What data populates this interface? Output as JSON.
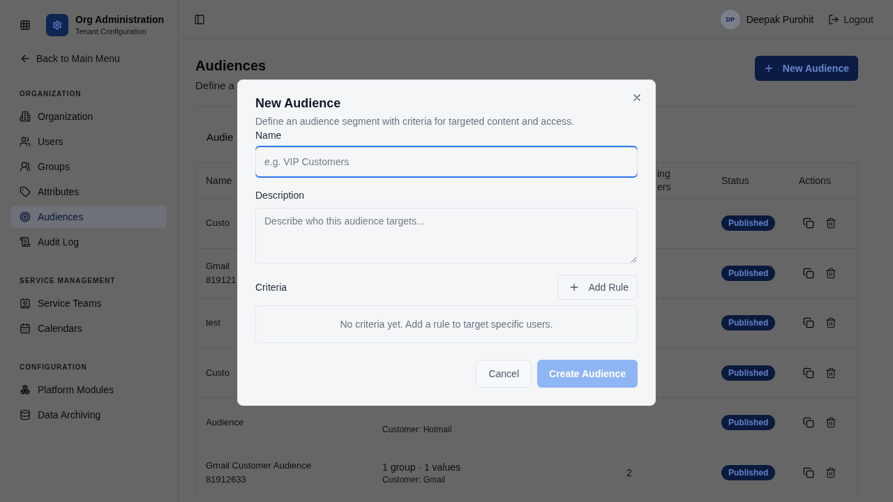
{
  "sidebar": {
    "title": "Org Administration",
    "subtitle": "Tenant Configuration",
    "back_link": "Back to Main Menu",
    "sections": [
      {
        "heading": "ORGANIZATION",
        "items": [
          {
            "label": "Organization",
            "selected": false
          },
          {
            "label": "Users",
            "selected": false
          },
          {
            "label": "Groups",
            "selected": false
          },
          {
            "label": "Attributes",
            "selected": false
          },
          {
            "label": "Audiences",
            "selected": true
          },
          {
            "label": "Audit Log",
            "selected": false
          }
        ]
      },
      {
        "heading": "SERVICE MANAGEMENT",
        "items": [
          {
            "label": "Service Teams",
            "selected": false
          },
          {
            "label": "Calendars",
            "selected": false
          }
        ]
      },
      {
        "heading": "CONFIGURATION",
        "items": [
          {
            "label": "Platform Modules",
            "selected": false
          },
          {
            "label": "Data Archiving",
            "selected": false
          }
        ]
      }
    ]
  },
  "topbar": {
    "user": {
      "initials": "DP",
      "name": "Deepak Purohit"
    },
    "logout": "Logout"
  },
  "page": {
    "title": "Audiences",
    "subtitle": "Define a",
    "new_button": "New Audience"
  },
  "table": {
    "title": "Audie",
    "header": {
      "name": "Name",
      "column_3": "ing\ners",
      "status": "Status",
      "actions": "Actions"
    },
    "rows": [
      {
        "name": "Custo",
        "status": "Published"
      },
      {
        "name": "Gmail\n819121",
        "status": "Published"
      },
      {
        "name": "test",
        "status": "Published"
      },
      {
        "name": "Custo",
        "status": "Published"
      },
      {
        "name": "Audience",
        "column_2": {
          "detail": "Customer: Hotmail"
        },
        "status": "Published"
      },
      {
        "name": "Gmail Customer Audience 81912633",
        "column_2": {
          "summary": "1 group · 1 values",
          "detail": "Customer: Gmail"
        },
        "column_3": "2",
        "status": "Published"
      }
    ]
  },
  "modal": {
    "title": "New Audience",
    "description": "Define an audience segment with criteria for targeted content and access.",
    "fields": [
      {
        "kind": "input",
        "label": "Name",
        "placeholder": "e.g. VIP Customers",
        "focused": true
      },
      {
        "kind": "textarea",
        "label": "Description",
        "placeholder": "Describe who this audience targets...",
        "focused": false
      }
    ],
    "criteria": {
      "label": "Criteria",
      "add_button": "Add Rule",
      "empty_text": "No criteria yet. Add a rule to target specific users."
    },
    "buttons": [
      {
        "kind": "secondary",
        "label": "Cancel",
        "disabled": false
      },
      {
        "kind": "primary",
        "label": "Create Audience",
        "disabled": true
      }
    ]
  }
}
